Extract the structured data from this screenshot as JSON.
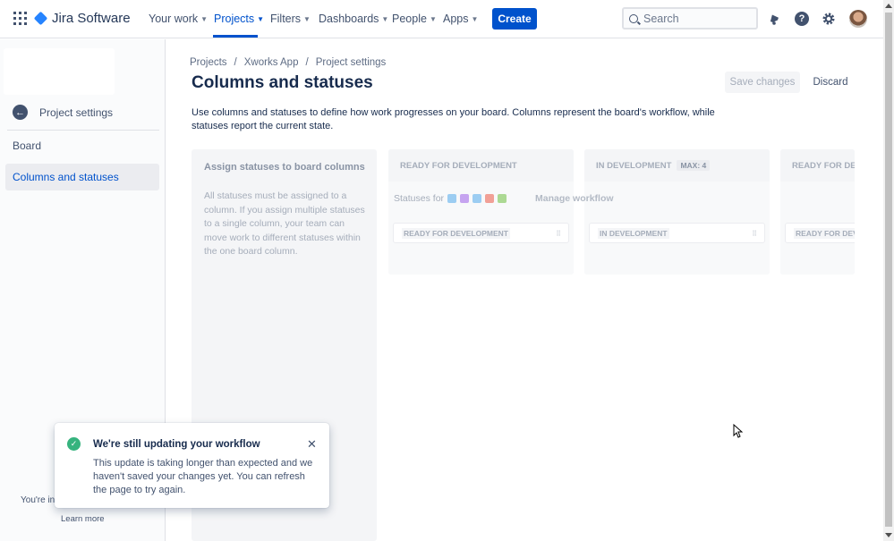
{
  "topnav": {
    "brand": "Jira Software",
    "items": [
      {
        "label": "Your work",
        "active": false
      },
      {
        "label": "Projects",
        "active": true
      },
      {
        "label": "Filters",
        "active": false
      },
      {
        "label": "Dashboards",
        "active": false
      },
      {
        "label": "People",
        "active": false
      },
      {
        "label": "Apps",
        "active": false
      }
    ],
    "create_label": "Create",
    "search_placeholder": "Search",
    "accent_color": "#0052cc"
  },
  "sidebar": {
    "back_label": "Project settings",
    "items": [
      {
        "label": "Board",
        "selected": false
      },
      {
        "label": "Columns and statuses",
        "selected": true
      }
    ],
    "footer_text": "You're in",
    "learn_more": "Learn more"
  },
  "main": {
    "breadcrumb": [
      "Projects",
      "Xworks App",
      "Project settings"
    ],
    "title": "Columns and statuses",
    "save_label": "Save changes",
    "discard_label": "Discard",
    "description": "Use columns and statuses to define how work progresses on your board. Columns represent the board's workflow, while statuses report the current state."
  },
  "assign_panel": {
    "title": "Assign statuses to board columns",
    "text": "All statuses must be assigned to a column. If you assign multiple statuses to a single column, your team can move work to different statuses within the one board column."
  },
  "statuses_for": {
    "label": "Statuses for",
    "issue_type_icons": [
      {
        "name": "task-icon",
        "color": "#4bade8"
      },
      {
        "name": "epic-icon",
        "color": "#904ee2"
      },
      {
        "name": "subtask-icon",
        "color": "#4bade8"
      },
      {
        "name": "bug-icon",
        "color": "#e5493a"
      },
      {
        "name": "story-icon",
        "color": "#63ba3c"
      }
    ],
    "manage_label": "Manage workflow"
  },
  "columns": [
    {
      "title": "READY FOR DEVELOPMENT",
      "max": "",
      "status": "READY FOR DEVELOPMENT"
    },
    {
      "title": "IN DEVELOPMENT",
      "max": "MAX: 4",
      "status": "IN DEVELOPMENT"
    },
    {
      "title": "READY FOR DEVA",
      "max": "",
      "status": "READY FOR DEVA"
    }
  ],
  "toast": {
    "title": "We're still updating your workflow",
    "body": "This update is taking longer than expected and we haven't saved your changes yet. You can refresh the page to try again.",
    "status_color": "#36b37e"
  }
}
